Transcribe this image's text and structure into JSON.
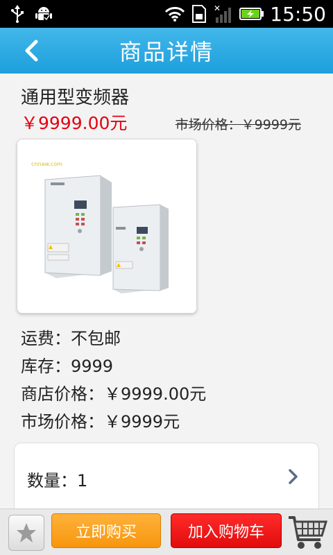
{
  "status_bar": {
    "time": "15:50",
    "icons": [
      "usb-icon",
      "android-icon",
      "wifi-icon",
      "sd-card-icon",
      "no-signal-icon",
      "battery-charging-icon"
    ]
  },
  "header": {
    "title": "商品详情",
    "back_icon": "chevron-left-icon"
  },
  "product": {
    "name": "通用型变频器",
    "price": "￥9999.00元",
    "market_price": "市场价格：￥9999元",
    "image_caption": "inverter-product-image"
  },
  "details": {
    "shipping": "运费：不包邮",
    "stock": "库存：9999",
    "store_price": "商店价格：￥9999.00元",
    "market_price": "市场价格：￥9999元"
  },
  "quantity": {
    "label": "数量：1"
  },
  "bottom_bar": {
    "favorite_icon": "star-icon",
    "buy_now": "立即购买",
    "add_to_cart": "加入购物车",
    "cart_icon": "shopping-cart-icon"
  },
  "colors": {
    "accent_blue": "#29a8e2",
    "price_red": "#e60012",
    "buy_orange": "#f7960d",
    "cart_red": "#e20c0c"
  }
}
